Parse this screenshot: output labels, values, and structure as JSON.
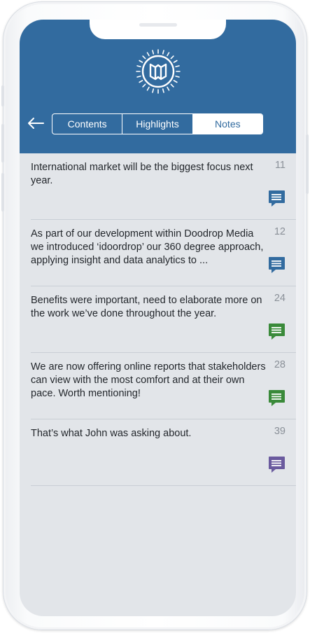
{
  "header": {
    "logo_icon": "book-sun-logo-icon",
    "back_icon": "arrow-left-icon",
    "tabs": [
      {
        "label": "Contents",
        "active": false
      },
      {
        "label": "Highlights",
        "active": false
      },
      {
        "label": "Notes",
        "active": true
      }
    ]
  },
  "colors": {
    "header": "#326b9f",
    "screen_bg": "#e2e5e9",
    "blue": "#326b9f",
    "green": "#3a8a3a",
    "purple": "#6a5a9e"
  },
  "notes": [
    {
      "text": "International market will be the biggest focus next year.",
      "page": "11",
      "color": "#326b9f",
      "icon": "comment-icon"
    },
    {
      "text": "As part of our development within Doodrop Media we introduced ‘idoordrop’ our 360 degree approach, applying insight and data analytics to ...",
      "page": "12",
      "color": "#326b9f",
      "icon": "comment-icon"
    },
    {
      "text": "Benefits were important, need to elaborate more on the work we’ve done throughout the year.",
      "page": "24",
      "color": "#3a8a3a",
      "icon": "comment-icon"
    },
    {
      "text": "We are now offering online reports that stakeholders can view with the most comfort and at their own pace. Worth mentioning!",
      "page": "28",
      "color": "#3a8a3a",
      "icon": "comment-icon"
    },
    {
      "text": "That’s what John was asking about.",
      "page": "39",
      "color": "#6a5a9e",
      "icon": "comment-icon"
    }
  ]
}
